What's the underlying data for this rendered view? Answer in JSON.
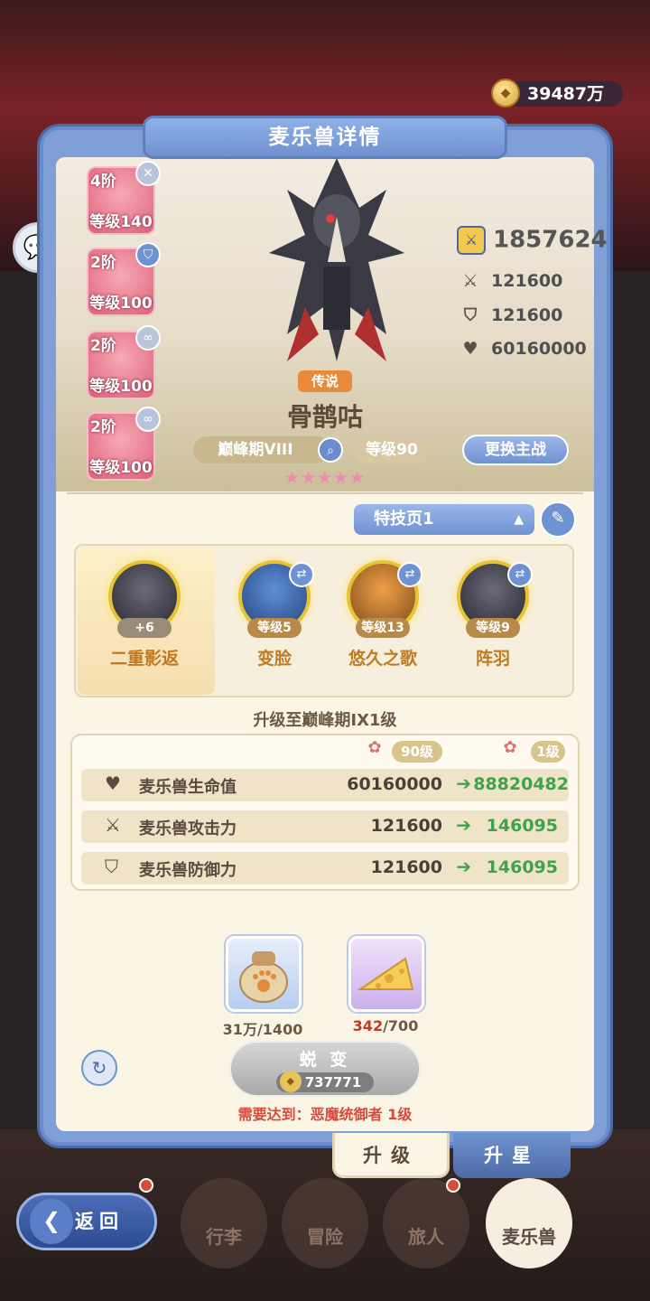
{
  "currency": {
    "amount": "39487万"
  },
  "header": {
    "title": "麦乐兽详情"
  },
  "side_cards": [
    {
      "tier": "4阶",
      "level": "等级140",
      "badge": "x-badge-icon"
    },
    {
      "tier": "2阶",
      "level": "等级100",
      "badge": "shield-badge-icon"
    },
    {
      "tier": "2阶",
      "level": "等级100",
      "badge": "swirl-badge-icon"
    },
    {
      "tier": "2阶",
      "level": "等级100",
      "badge": "swirl-badge-icon"
    }
  ],
  "pet": {
    "rarity": "传说",
    "name": "骨鹊咕",
    "stage": "巅峰期VIII",
    "level": "等级90",
    "swap_label": "更换主战",
    "stars": "★★★★★",
    "power": "1857624",
    "attack": "121600",
    "defense": "121600",
    "hp": "60160000"
  },
  "skills": {
    "page_label": "特技页1",
    "items": [
      {
        "name": "二重影返",
        "level": "+6"
      },
      {
        "name": "变脸",
        "level": "等级5"
      },
      {
        "name": "悠久之歌",
        "level": "等级13"
      },
      {
        "name": "阵羽",
        "level": "等级9"
      }
    ]
  },
  "upgrade": {
    "title": "升级至巅峰期IX1级",
    "from_label": "90级",
    "to_label": "1级",
    "rows": [
      {
        "label": "麦乐兽生命值",
        "current": "60160000",
        "next": "88820482",
        "icon": "heart-icon"
      },
      {
        "label": "麦乐兽攻击力",
        "current": "121600",
        "next": "146095",
        "icon": "swords-icon"
      },
      {
        "label": "麦乐兽防御力",
        "current": "121600",
        "next": "146095",
        "icon": "shield-icon"
      }
    ]
  },
  "materials": [
    {
      "name": "paw-food-sack",
      "have": "31万",
      "need": "/1400",
      "color": "#e0a040"
    },
    {
      "name": "cheese",
      "have": "342",
      "need": "/700",
      "color": "#c0392b"
    }
  ],
  "evolve": {
    "label": "蜕 变",
    "cost": "737771",
    "requirement": "需要达到：恶魔统御者 1级"
  },
  "tabs": {
    "upgrade": "升级",
    "star": "升星"
  },
  "bottom_nav": {
    "back": "返回",
    "items": [
      "行李",
      "冒险",
      "旅人",
      "麦乐兽"
    ]
  },
  "colors": {
    "accent_blue": "#6f92d0",
    "green": "#3fa34a",
    "red": "#d44b3b",
    "gold": "#e8c25a"
  }
}
